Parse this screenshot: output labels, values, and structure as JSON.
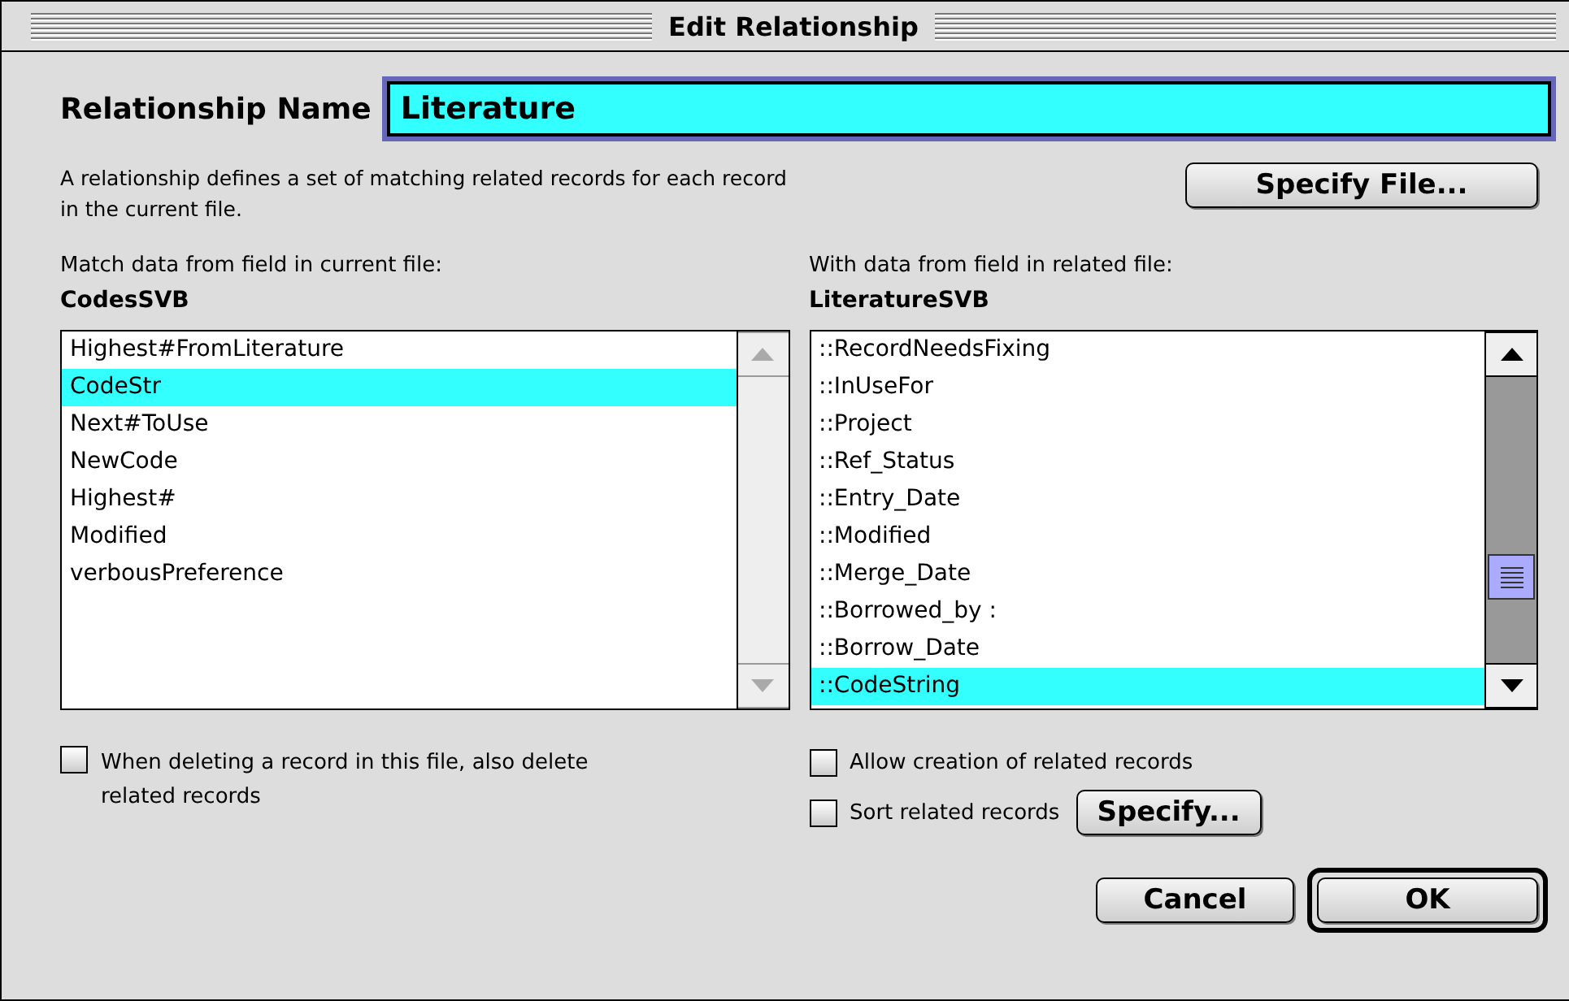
{
  "window": {
    "title": "Edit Relationship"
  },
  "name_field": {
    "label": "Relationship Name",
    "value": "Literature"
  },
  "description": "A relationship defines a set of matching related records for each record in the current file.",
  "specify_file_button": "Specify File...",
  "left": {
    "caption": "Match data from field in current file:",
    "file": "CodesSVB",
    "scroll_enabled": false,
    "items": [
      {
        "label": "Highest#FromLiterature",
        "selected": false
      },
      {
        "label": "CodeStr",
        "selected": true
      },
      {
        "label": "Next#ToUse",
        "selected": false
      },
      {
        "label": "NewCode",
        "selected": false
      },
      {
        "label": "Highest#",
        "selected": false
      },
      {
        "label": "Modified",
        "selected": false
      },
      {
        "label": "verbousPreference",
        "selected": false
      }
    ]
  },
  "right": {
    "caption": "With data from field in related file:",
    "file": "LiteratureSVB",
    "scroll_enabled": true,
    "items": [
      {
        "label": "::RecordNeedsFixing",
        "selected": false
      },
      {
        "label": "::InUseFor",
        "selected": false
      },
      {
        "label": "::Project",
        "selected": false
      },
      {
        "label": "::Ref_Status",
        "selected": false
      },
      {
        "label": "::Entry_Date",
        "selected": false
      },
      {
        "label": "::Modified",
        "selected": false
      },
      {
        "label": "::Merge_Date",
        "selected": false
      },
      {
        "label": "::Borrowed_by :",
        "selected": false
      },
      {
        "label": "::Borrow_Date",
        "selected": false
      },
      {
        "label": "::CodeString",
        "selected": true
      }
    ]
  },
  "delete_option": {
    "label": "When deleting a record in this file, also delete related records",
    "checked": false
  },
  "right_options": [
    {
      "label": "Allow creation of related records",
      "checked": false
    },
    {
      "label": "Sort related records",
      "checked": false,
      "button": "Specify..."
    }
  ],
  "buttons": [
    {
      "label": "Cancel",
      "default": false
    },
    {
      "label": "OK",
      "default": true
    }
  ]
}
